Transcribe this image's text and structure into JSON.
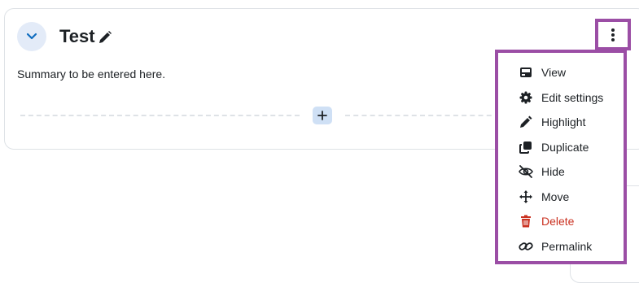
{
  "section": {
    "title": "Test",
    "summary": "Summary to be entered here."
  },
  "icons": {
    "collapse": "chevron-down-icon",
    "edit_title": "pencil-icon",
    "add": "plus-icon",
    "actions": "kebab-icon"
  },
  "menu": {
    "items": [
      {
        "label": "View",
        "icon": "view-icon",
        "danger": false
      },
      {
        "label": "Edit settings",
        "icon": "gear-icon",
        "danger": false
      },
      {
        "label": "Highlight",
        "icon": "pen-icon",
        "danger": false
      },
      {
        "label": "Duplicate",
        "icon": "copy-icon",
        "danger": false
      },
      {
        "label": "Hide",
        "icon": "eye-slash-icon",
        "danger": false
      },
      {
        "label": "Move",
        "icon": "arrows-move-icon",
        "danger": false
      },
      {
        "label": "Delete",
        "icon": "trash-icon",
        "danger": true
      },
      {
        "label": "Permalink",
        "icon": "link-icon",
        "danger": false
      }
    ]
  },
  "colors": {
    "highlight_border": "#9b4ea5",
    "danger": "#ca3120",
    "accent": "#0f6cbf"
  }
}
